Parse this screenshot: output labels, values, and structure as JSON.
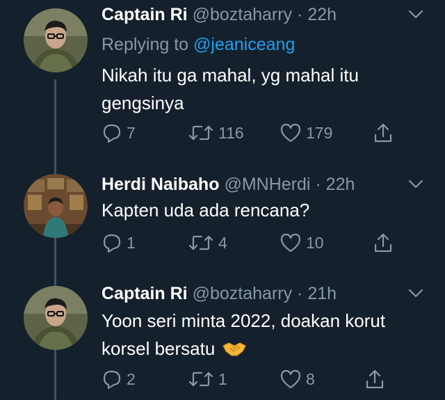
{
  "tweets": [
    {
      "name": "Captain Ri",
      "handle": "@boztaharry",
      "dot": "·",
      "time": "22h",
      "reply_prefix": "Replying to",
      "reply_to": "@jeaniceang",
      "text_lines": [
        "Nikah itu ga mahal, yg mahal itu",
        "gengsinya"
      ],
      "replies": "7",
      "retweets": "116",
      "likes": "179"
    },
    {
      "name": "Herdi Naibaho",
      "handle": "@MNHerdi",
      "dot": "·",
      "time": "22h",
      "text_lines": [
        "Kapten uda ada rencana?"
      ],
      "replies": "1",
      "retweets": "4",
      "likes": "10"
    },
    {
      "name": "Captain Ri",
      "handle": "@boztaharry",
      "dot": "·",
      "time": "21h",
      "text_lines": [
        "Yoon seri minta 2022, doakan korut",
        "korsel bersatu"
      ],
      "emoji": "handshake",
      "replies": "2",
      "retweets": "1",
      "likes": "8"
    }
  ],
  "colors": {
    "background": "#14202b",
    "text_primary": "#ffffff",
    "text_secondary": "#8899a6",
    "link": "#1da1f2",
    "thread_line": "#3d5466"
  },
  "icons": [
    "reply-icon",
    "retweet-icon",
    "like-icon",
    "share-icon",
    "chevron-down-icon",
    "handshake-emoji"
  ]
}
